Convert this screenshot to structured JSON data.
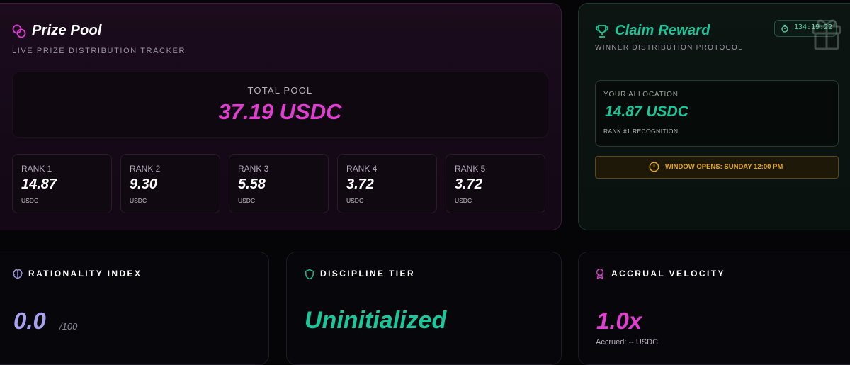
{
  "prize_pool": {
    "title": "Prize Pool",
    "subtitle": "LIVE PRIZE DISTRIBUTION TRACKER",
    "icon": "coins-icon",
    "total_label": "TOTAL POOL",
    "total_value": "37.19 USDC",
    "ranks": [
      {
        "label": "RANK 1",
        "value": "14.87",
        "unit": "USDC"
      },
      {
        "label": "RANK 2",
        "value": "9.30",
        "unit": "USDC"
      },
      {
        "label": "RANK 3",
        "value": "5.58",
        "unit": "USDC"
      },
      {
        "label": "RANK 4",
        "value": "3.72",
        "unit": "USDC"
      },
      {
        "label": "RANK 5",
        "value": "3.72",
        "unit": "USDC"
      }
    ]
  },
  "claim_reward": {
    "title": "Claim Reward",
    "subtitle": "WINNER DISTRIBUTION PROTOCOL",
    "icon": "trophy-icon",
    "timer": "134:19:22",
    "allocation_label": "YOUR ALLOCATION",
    "allocation_value": "14.87 USDC",
    "allocation_note": "RANK #1 RECOGNITION",
    "window_notice": "WINDOW OPENS: SUNDAY 12:00 PM"
  },
  "stats": {
    "rationality": {
      "title": "RATIONALITY INDEX",
      "value": "0.0",
      "suffix": "/100",
      "icon": "brain-icon"
    },
    "discipline": {
      "title": "DISCIPLINE TIER",
      "value": "Uninitialized",
      "icon": "shield-icon"
    },
    "velocity": {
      "title": "ACCRUAL VELOCITY",
      "value": "1.0x",
      "note": "Accrued: -- USDC",
      "icon": "medal-icon"
    }
  },
  "colors": {
    "magenta": "#e03ed0",
    "green": "#19c79a",
    "amber": "#e3a81a",
    "violet": "#a6a2f0"
  }
}
